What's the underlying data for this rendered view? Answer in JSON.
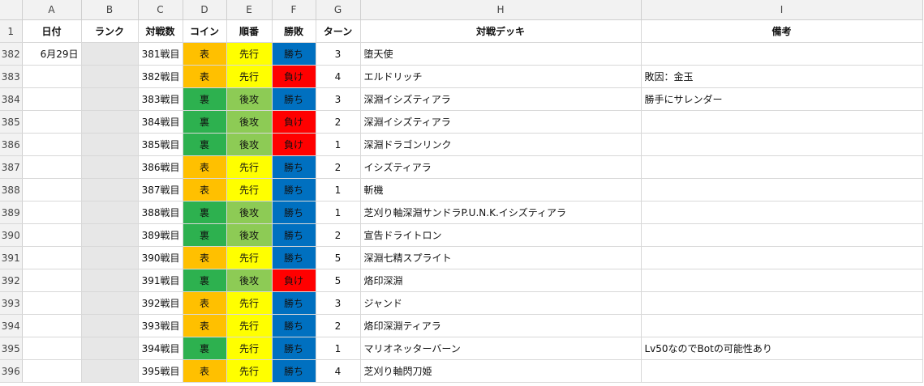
{
  "columns": [
    "A",
    "B",
    "C",
    "D",
    "E",
    "F",
    "G",
    "H",
    "I"
  ],
  "colors": {
    "omote": "#FFC000",
    "ura": "#2DB14F",
    "senko": "#FFFF00",
    "koko": "#8DCB55",
    "win": "#0070C0",
    "lose": "#FF0000",
    "rank_bg": "#E7E7E7",
    "header_bg": "#F2F2F2"
  },
  "header": {
    "row_num": "1",
    "date": "日付",
    "rank": "ランク",
    "match": "対戦数",
    "coin": "コイン",
    "order": "順番",
    "result": "勝敗",
    "turns": "ターン",
    "deck": "対戦デッキ",
    "notes": "備考"
  },
  "rows": [
    {
      "num": "382",
      "date": "6月29日",
      "match": "381戦目",
      "coin": "表",
      "order": "先行",
      "result": "勝ち",
      "turns": "3",
      "deck": "堕天使",
      "notes": ""
    },
    {
      "num": "383",
      "date": "",
      "match": "382戦目",
      "coin": "表",
      "order": "先行",
      "result": "負け",
      "turns": "4",
      "deck": "エルドリッチ",
      "notes": "敗因：金玉"
    },
    {
      "num": "384",
      "date": "",
      "match": "383戦目",
      "coin": "裏",
      "order": "後攻",
      "result": "勝ち",
      "turns": "3",
      "deck": "深淵イシズティアラ",
      "notes": "勝手にサレンダー"
    },
    {
      "num": "385",
      "date": "",
      "match": "384戦目",
      "coin": "裏",
      "order": "後攻",
      "result": "負け",
      "turns": "2",
      "deck": "深淵イシズティアラ",
      "notes": ""
    },
    {
      "num": "386",
      "date": "",
      "match": "385戦目",
      "coin": "裏",
      "order": "後攻",
      "result": "負け",
      "turns": "1",
      "deck": "深淵ドラゴンリンク",
      "notes": ""
    },
    {
      "num": "387",
      "date": "",
      "match": "386戦目",
      "coin": "表",
      "order": "先行",
      "result": "勝ち",
      "turns": "2",
      "deck": "イシズティアラ",
      "notes": ""
    },
    {
      "num": "388",
      "date": "",
      "match": "387戦目",
      "coin": "表",
      "order": "先行",
      "result": "勝ち",
      "turns": "1",
      "deck": "斬機",
      "notes": ""
    },
    {
      "num": "389",
      "date": "",
      "match": "388戦目",
      "coin": "裏",
      "order": "後攻",
      "result": "勝ち",
      "turns": "1",
      "deck": "芝刈り軸深淵サンドラP.U.N.K.イシズティアラ",
      "notes": ""
    },
    {
      "num": "390",
      "date": "",
      "match": "389戦目",
      "coin": "裏",
      "order": "後攻",
      "result": "勝ち",
      "turns": "2",
      "deck": "宣告ドライトロン",
      "notes": ""
    },
    {
      "num": "391",
      "date": "",
      "match": "390戦目",
      "coin": "表",
      "order": "先行",
      "result": "勝ち",
      "turns": "5",
      "deck": "深淵七精スプライト",
      "notes": ""
    },
    {
      "num": "392",
      "date": "",
      "match": "391戦目",
      "coin": "裏",
      "order": "後攻",
      "result": "負け",
      "turns": "5",
      "deck": "烙印深淵",
      "notes": ""
    },
    {
      "num": "393",
      "date": "",
      "match": "392戦目",
      "coin": "表",
      "order": "先行",
      "result": "勝ち",
      "turns": "3",
      "deck": "ジャンド",
      "notes": ""
    },
    {
      "num": "394",
      "date": "",
      "match": "393戦目",
      "coin": "表",
      "order": "先行",
      "result": "勝ち",
      "turns": "2",
      "deck": "烙印深淵ティアラ",
      "notes": ""
    },
    {
      "num": "395",
      "date": "",
      "match": "394戦目",
      "coin": "裏",
      "order": "先行",
      "result": "勝ち",
      "turns": "1",
      "deck": "マリオネッターバーン",
      "notes": "Lv50なのでBotの可能性あり"
    },
    {
      "num": "396",
      "date": "",
      "match": "395戦目",
      "coin": "表",
      "order": "先行",
      "result": "勝ち",
      "turns": "4",
      "deck": "芝刈り軸閃刀姫",
      "notes": ""
    }
  ]
}
